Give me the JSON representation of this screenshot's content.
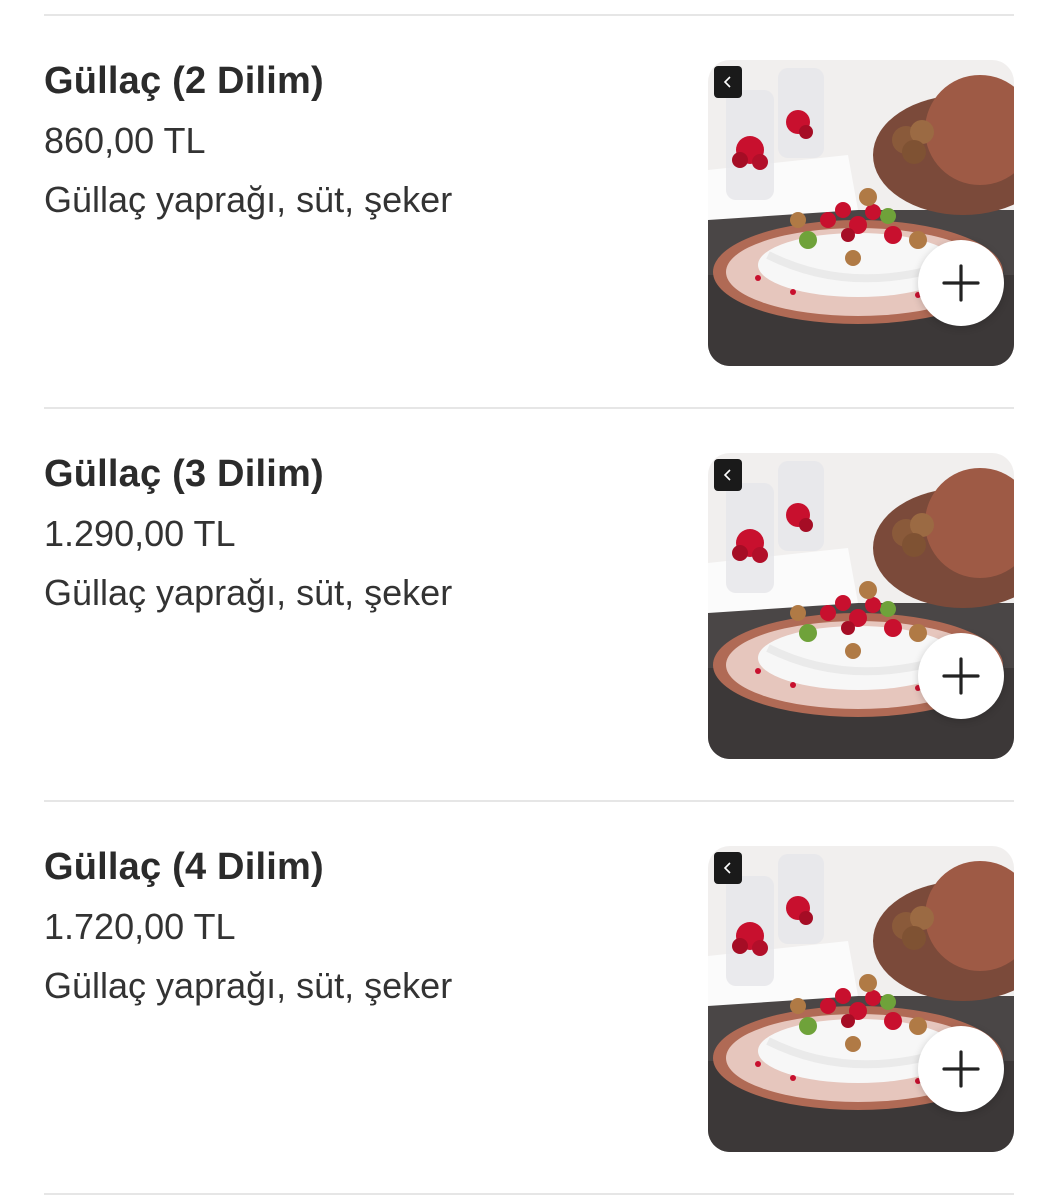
{
  "menu_items": [
    {
      "name": "Güllaç (2 Dilim)",
      "price": "860,00 TL",
      "description": "Güllaç yaprağı, süt, şeker",
      "image": "gullac-dessert-photo",
      "add_icon": "plus-icon",
      "back_icon": "chevron-left-icon"
    },
    {
      "name": "Güllaç (3 Dilim)",
      "price": "1.290,00 TL",
      "description": "Güllaç yaprağı, süt, şeker",
      "image": "gullac-dessert-photo",
      "add_icon": "plus-icon",
      "back_icon": "chevron-left-icon"
    },
    {
      "name": "Güllaç (4 Dilim)",
      "price": "1.720,00 TL",
      "description": "Güllaç yaprağı, süt, şeker",
      "image": "gullac-dessert-photo",
      "add_icon": "plus-icon",
      "back_icon": "chevron-left-icon"
    }
  ],
  "colors": {
    "divider": "#e6e6e6",
    "text_primary": "#2b2b2b",
    "pomegranate": "#c8102e",
    "copper_plate": "#b06a55"
  }
}
